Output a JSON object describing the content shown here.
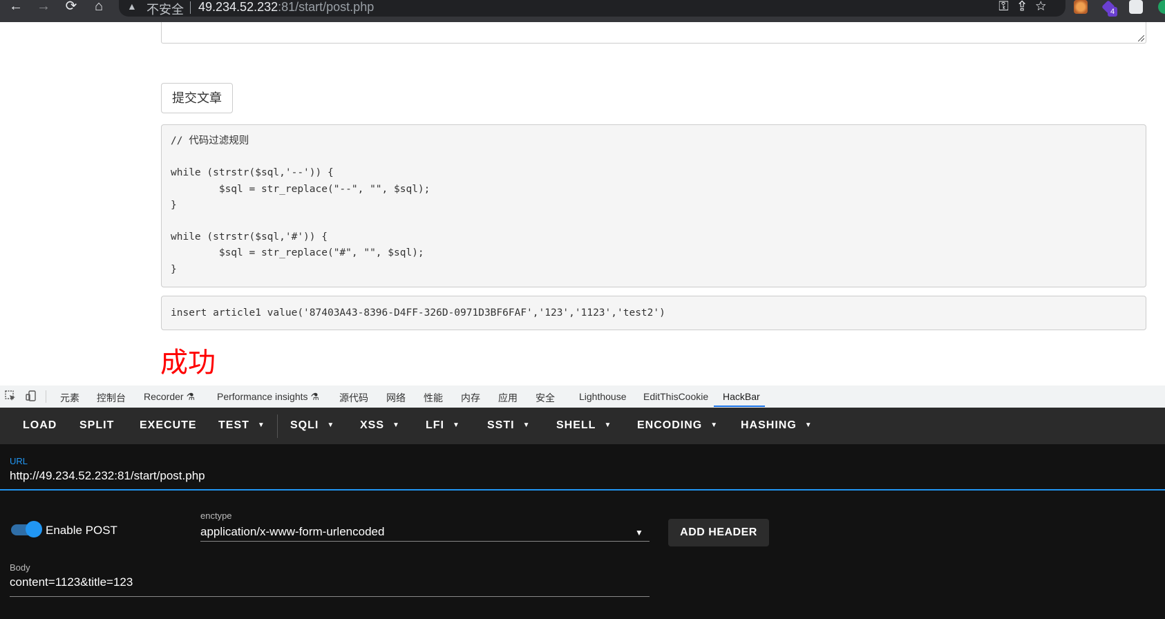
{
  "browser": {
    "back_glyph": "←",
    "forward_glyph": "→",
    "reload_glyph": "⟳",
    "home_glyph": "⌂",
    "security_label": "不安全",
    "url_host": "49.234.52.232",
    "url_rest": ":81/start/post.php",
    "right_icons": "⚿⇪☆",
    "extension_badge": "4"
  },
  "page": {
    "submit_label": "提交文章",
    "code_text": "// 代码过滤规则\n\nwhile (strstr($sql,'--')) {\n        $sql = str_replace(\"--\", \"\", $sql);\n}\n\nwhile (strstr($sql,'#')) {\n        $sql = str_replace(\"#\", \"\", $sql);\n}",
    "sql_text": "insert article1 value('87403A43-8396-D4FF-326D-0971D3BF6FAF','123','1123','test2')",
    "result_text": "成功",
    "result_color": "#ff0000"
  },
  "devtools": {
    "tabs": [
      "元素",
      "控制台",
      "Recorder ⚗",
      "Performance insights ⚗",
      "源代码",
      "网络",
      "性能",
      "内存",
      "应用",
      "安全",
      "Lighthouse",
      "EditThisCookie",
      "HackBar"
    ],
    "active_tab": "HackBar",
    "accent": "#1a73e8"
  },
  "hackbar": {
    "toolbar": [
      "LOAD",
      "SPLIT",
      "EXECUTE",
      "TEST",
      "SQLI",
      "XSS",
      "LFI",
      "SSTI",
      "SHELL",
      "ENCODING",
      "HASHING"
    ],
    "url_label": "URL",
    "url_value": "http://49.234.52.232:81/start/post.php",
    "enable_post_label": "Enable POST",
    "enable_post_on": true,
    "enctype_label": "enctype",
    "enctype_value": "application/x-www-form-urlencoded",
    "add_header_label": "ADD HEADER",
    "body_label": "Body",
    "body_value": "content=1123&title=123",
    "accent": "#2196f3"
  }
}
